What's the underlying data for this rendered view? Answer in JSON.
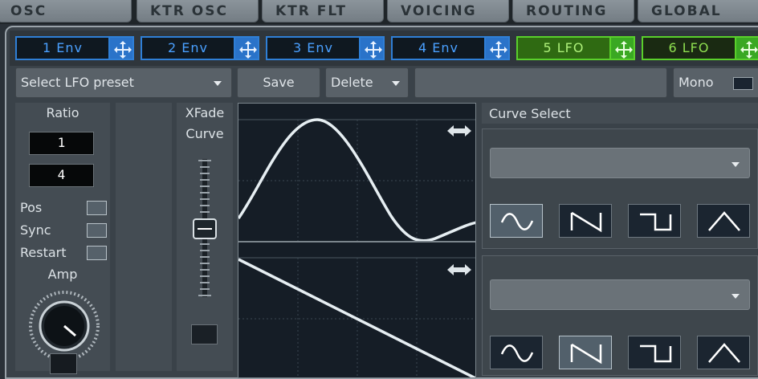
{
  "tabs": [
    {
      "label": "OSC"
    },
    {
      "label": "KTR OSC"
    },
    {
      "label": "KTR FLT"
    },
    {
      "label": "VOICING"
    },
    {
      "label": "ROUTING"
    },
    {
      "label": "GLOBAL"
    }
  ],
  "mod_sources": [
    {
      "label": "1 Env",
      "type": "env"
    },
    {
      "label": "2 Env",
      "type": "env"
    },
    {
      "label": "3 Env",
      "type": "env"
    },
    {
      "label": "4 Env",
      "type": "env"
    },
    {
      "label": "5 LFO",
      "type": "lfo",
      "active": true
    },
    {
      "label": "6 LFO",
      "type": "lfo"
    }
  ],
  "toolbar": {
    "preset_label": "Select LFO preset",
    "save_label": "Save",
    "delete_label": "Delete",
    "mono_label": "Mono"
  },
  "left": {
    "ratio_label": "Ratio",
    "ratio_top": "1",
    "ratio_bottom": "4",
    "pos_label": "Pos",
    "sync_label": "Sync",
    "restart_label": "Restart",
    "amp_label": "Amp"
  },
  "xfade": {
    "label_line1": "XFade",
    "label_line2": "Curve"
  },
  "curve_select": {
    "label": "Curve Select",
    "shapes": [
      "sine",
      "ramp-down",
      "square",
      "triangle"
    ],
    "top_selected": "sine",
    "bottom_selected": "ramp-down"
  },
  "colors": {
    "env_accent": "#2f7fd6",
    "lfo_accent": "#5ad02b",
    "curve_line": "#e6eef2"
  }
}
